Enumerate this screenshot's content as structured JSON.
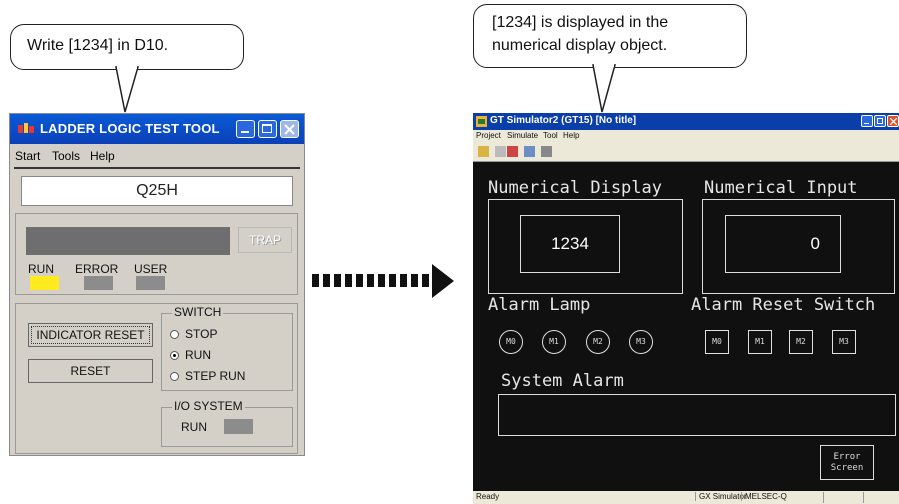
{
  "callouts": {
    "left": "Write [1234] in D10.",
    "right_line1": "[1234] is displayed in the",
    "right_line2": "numerical display object."
  },
  "ladder_tool": {
    "title": "LADDER LOGIC TEST TOOL",
    "menu": [
      "Start",
      "Tools",
      "Help"
    ],
    "cpu_type": "Q25H",
    "trap_label": "TRAP",
    "leds": [
      {
        "label": "RUN",
        "color": "#ffea1f"
      },
      {
        "label": "ERROR",
        "color": "#8c8c8c"
      },
      {
        "label": "USER",
        "color": "#8c8c8c"
      }
    ],
    "indicator_reset_label": "INDICATOR RESET",
    "reset_label": "RESET",
    "switch": {
      "label": "SWITCH",
      "options": [
        "STOP",
        "RUN",
        "STEP RUN"
      ],
      "selected": "RUN"
    },
    "io_system": {
      "label": "I/O SYSTEM",
      "status": "RUN"
    }
  },
  "gt_simulator": {
    "title": "GT Simulator2 (GT15)  [No title]",
    "menu": [
      "Project",
      "Simulate",
      "Tool",
      "Help"
    ],
    "numerical_display": {
      "label": "Numerical Display",
      "value": "1234"
    },
    "numerical_input": {
      "label": "Numerical Input",
      "value": "0"
    },
    "alarm_lamp": {
      "label": "Alarm Lamp",
      "lamps": [
        "M0",
        "M1",
        "M2",
        "M3"
      ]
    },
    "alarm_reset_switch": {
      "label": "Alarm Reset Switch",
      "switches": [
        "M0",
        "M1",
        "M2",
        "M3"
      ]
    },
    "system_alarm": {
      "label": "System Alarm"
    },
    "error_screen": {
      "line1": "Error",
      "line2": "Screen"
    },
    "status": {
      "left": "Ready",
      "mid1": "GX Simulator",
      "mid2": "MELSEC-Q"
    }
  }
}
